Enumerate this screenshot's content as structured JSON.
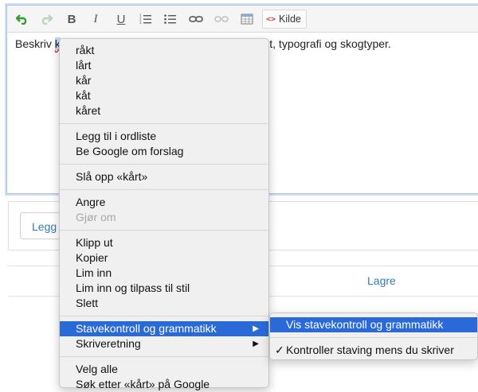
{
  "toolbar": {
    "source_label": "Kilde",
    "bold_glyph": "B",
    "italic_glyph": "I",
    "underline_glyph": "U"
  },
  "editor": {
    "text_before": "Beskriv ",
    "misspelled_word": "k",
    "text_after": "ighet, typografi og skogtyper."
  },
  "page": {
    "add_button_label": "Legg",
    "save_link": "Lagre"
  },
  "context_menu": {
    "suggestions": [
      "råkt",
      "lårt",
      "kår",
      "kåt",
      "kåret"
    ],
    "dictionary": [
      "Legg til i ordliste",
      "Be Google om forslag"
    ],
    "lookup": "Slå opp «kårt»",
    "undo": "Angre",
    "redo": "Gjør om",
    "edit": [
      "Klipp ut",
      "Kopier",
      "Lim inn",
      "Lim inn og tilpass til stil",
      "Slett"
    ],
    "spelling_grammar": "Stavekontroll og grammatikk",
    "writing_direction": "Skriveretning",
    "select_all": "Velg alle",
    "search_google": "Søk etter «kårt» på Google"
  },
  "submenu": {
    "show_spelling": "Vis stavekontroll og grammatikk",
    "check_while_typing": "Kontroller staving mens du skriver",
    "checkmark": "✓"
  },
  "colors": {
    "highlight": "#2a6ad8",
    "link": "#337ab7",
    "focus_border": "#aac4e0"
  }
}
